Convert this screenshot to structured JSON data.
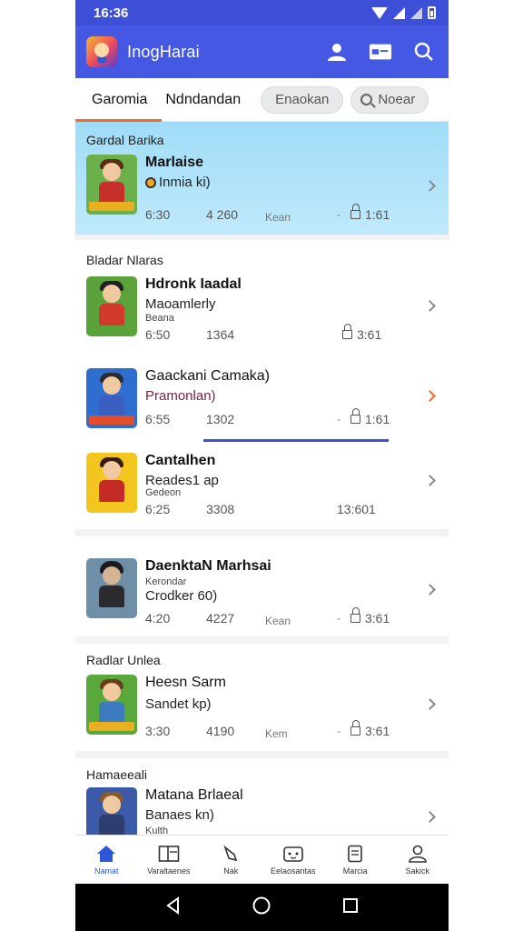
{
  "status_bar": {
    "time": "16:36"
  },
  "app_bar": {
    "title": "InogHarai"
  },
  "tabs": [
    {
      "label": "Garomia"
    },
    {
      "label": "Ndndandan"
    }
  ],
  "chips": {
    "filter_label": "Enaokan",
    "search_label": "Noear"
  },
  "featured": {
    "section_label": "Gardal Barika",
    "title": "Marlaise",
    "subtitle": "Inmia ki)",
    "meta_time": "6:30",
    "meta_count": "4 260",
    "meta_tag": "Kean",
    "meta_locks": "1:61"
  },
  "section_1": {
    "header": "Bladar Nlaras",
    "items": [
      {
        "title": "Hdronk Iaadal",
        "subtitle": "Maoamlerly",
        "sub2": "Beana",
        "time": "6:50",
        "count": "1364",
        "tag": "",
        "locks": "3:61",
        "dash": ""
      },
      {
        "title": "Gaackani Camaka)",
        "subtitle": "Pramonlan)",
        "sub2": "",
        "time": "6:55",
        "count": "1302",
        "tag": "",
        "locks": "1:61",
        "dash": "-"
      },
      {
        "title": "Cantalhen",
        "subtitle": "Reades1 ap",
        "sub2": "Gedeon",
        "time": "6:25",
        "count": "3308",
        "tag": "",
        "locks": "13:601",
        "dash": ""
      }
    ]
  },
  "section_2": {
    "items": [
      {
        "title": "DaenktaN Marhsai",
        "subtitle": "Crodker 60)",
        "sub2": "Kerondar",
        "time": "4:20",
        "count": "4227",
        "tag": "Kean",
        "locks": "3:61",
        "dash": "-"
      }
    ]
  },
  "section_3": {
    "header": "Radlar Unlea",
    "items": [
      {
        "title": "Heesn Sarm",
        "subtitle": "Sandet kp)",
        "sub2": "",
        "time": "3:30",
        "count": "4190",
        "tag": "Kem",
        "locks": "3:61",
        "dash": "-"
      }
    ]
  },
  "section_4": {
    "header": "Hamaeeali",
    "items": [
      {
        "title": "Matana Brlaeal",
        "subtitle": "Banaes kn)",
        "sub2": "Kulth"
      }
    ]
  },
  "bottom_nav": [
    {
      "label": "Namat",
      "icon": "home-icon"
    },
    {
      "label": "Varaltaenes",
      "icon": "book-icon"
    },
    {
      "label": "Nak",
      "icon": "bag-icon"
    },
    {
      "label": "Eelaosantas",
      "icon": "controller-icon"
    },
    {
      "label": "Marcia",
      "icon": "document-icon"
    },
    {
      "label": "Sakick",
      "icon": "profile-icon"
    }
  ],
  "colors": {
    "primary": "#4458e4",
    "accent": "#f26a2e",
    "featured_bg": "#9fdcf7"
  }
}
